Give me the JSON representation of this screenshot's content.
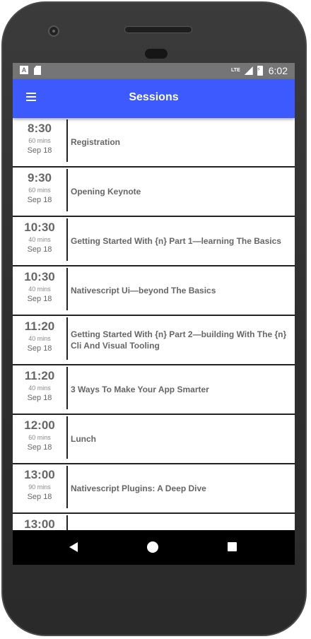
{
  "status_bar": {
    "left_icons": [
      "a-notification-icon",
      "sd-card-icon"
    ],
    "a_glyph": "A",
    "network": "LTE",
    "time": "6:02"
  },
  "app_bar": {
    "title": "Sessions",
    "menu_icon": "hamburger-menu-icon"
  },
  "sessions": [
    {
      "time": "8:30",
      "duration": "60 mins",
      "date": "Sep 18",
      "title": "Registration"
    },
    {
      "time": "9:30",
      "duration": "60 mins",
      "date": "Sep 18",
      "title": "Opening Keynote"
    },
    {
      "time": "10:30",
      "duration": "40 mins",
      "date": "Sep 18",
      "title": "Getting Started With {n} Part 1—learning The Basics"
    },
    {
      "time": "10:30",
      "duration": "40 mins",
      "date": "Sep 18",
      "title": "Nativescript Ui—beyond The Basics"
    },
    {
      "time": "11:20",
      "duration": "40 mins",
      "date": "Sep 18",
      "title": "Getting Started With {n} Part 2—building With The {n} Cli And Visual Tooling"
    },
    {
      "time": "11:20",
      "duration": "40 mins",
      "date": "Sep 18",
      "title": "3 Ways To Make Your App Smarter"
    },
    {
      "time": "12:00",
      "duration": "60 mins",
      "date": "Sep 18",
      "title": "Lunch"
    },
    {
      "time": "13:00",
      "duration": "90 mins",
      "date": "Sep 18",
      "title": "Nativescript Plugins: A Deep Dive"
    },
    {
      "time": "13:00",
      "duration": "",
      "date": "",
      "title": ""
    }
  ],
  "nav_bar": {
    "buttons": [
      "back-icon",
      "home-icon",
      "recent-apps-icon"
    ]
  },
  "colors": {
    "app_bar": "#3d5afe",
    "status_bar": "#757575",
    "text": "#666666",
    "divider": "#222222"
  }
}
